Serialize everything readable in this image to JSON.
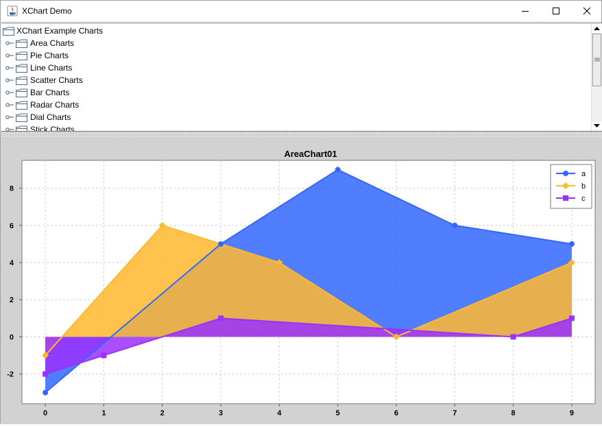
{
  "window": {
    "title": "XChart Demo",
    "app_icon": "java-icon",
    "controls": [
      "minimize-icon",
      "maximize-icon",
      "close-icon"
    ]
  },
  "tree": {
    "root": "XChart Example Charts",
    "items": [
      {
        "label": "Area Charts"
      },
      {
        "label": "Pie Charts"
      },
      {
        "label": "Line Charts"
      },
      {
        "label": "Scatter Charts"
      },
      {
        "label": "Bar Charts"
      },
      {
        "label": "Radar Charts"
      },
      {
        "label": "Dial Charts"
      },
      {
        "label": "Stick Charts"
      }
    ]
  },
  "chart_data": {
    "type": "area",
    "title": "AreaChart01",
    "xlabel": "",
    "ylabel": "",
    "x": [
      0,
      1,
      2,
      3,
      4,
      5,
      6,
      7,
      8,
      9
    ],
    "x_ticks": [
      "0",
      "1",
      "2",
      "3",
      "4",
      "5",
      "6",
      "7",
      "8",
      "9"
    ],
    "y_ticks": [
      "-2",
      "0",
      "2",
      "4",
      "6",
      "8"
    ],
    "xlim": [
      -0.4,
      9.4
    ],
    "ylim": [
      -3.6,
      9.5
    ],
    "grid": true,
    "legend_position": "top-right",
    "plot_background": "#ffffff",
    "panel_background": "#d2d2d2",
    "series": [
      {
        "name": "a",
        "color": "#3366ff",
        "marker": "circle",
        "x": [
          0,
          3,
          5,
          7,
          9
        ],
        "y": [
          -3,
          5,
          9,
          6,
          5
        ]
      },
      {
        "name": "b",
        "color": "#ffb92e",
        "marker": "diamond",
        "x": [
          0,
          2,
          4,
          6,
          9
        ],
        "y": [
          -1,
          6,
          4,
          0,
          4
        ]
      },
      {
        "name": "c",
        "color": "#9b30ff",
        "marker": "square",
        "x": [
          0,
          1,
          3,
          8,
          9
        ],
        "y": [
          -2,
          -1,
          1,
          0,
          1
        ]
      }
    ]
  }
}
